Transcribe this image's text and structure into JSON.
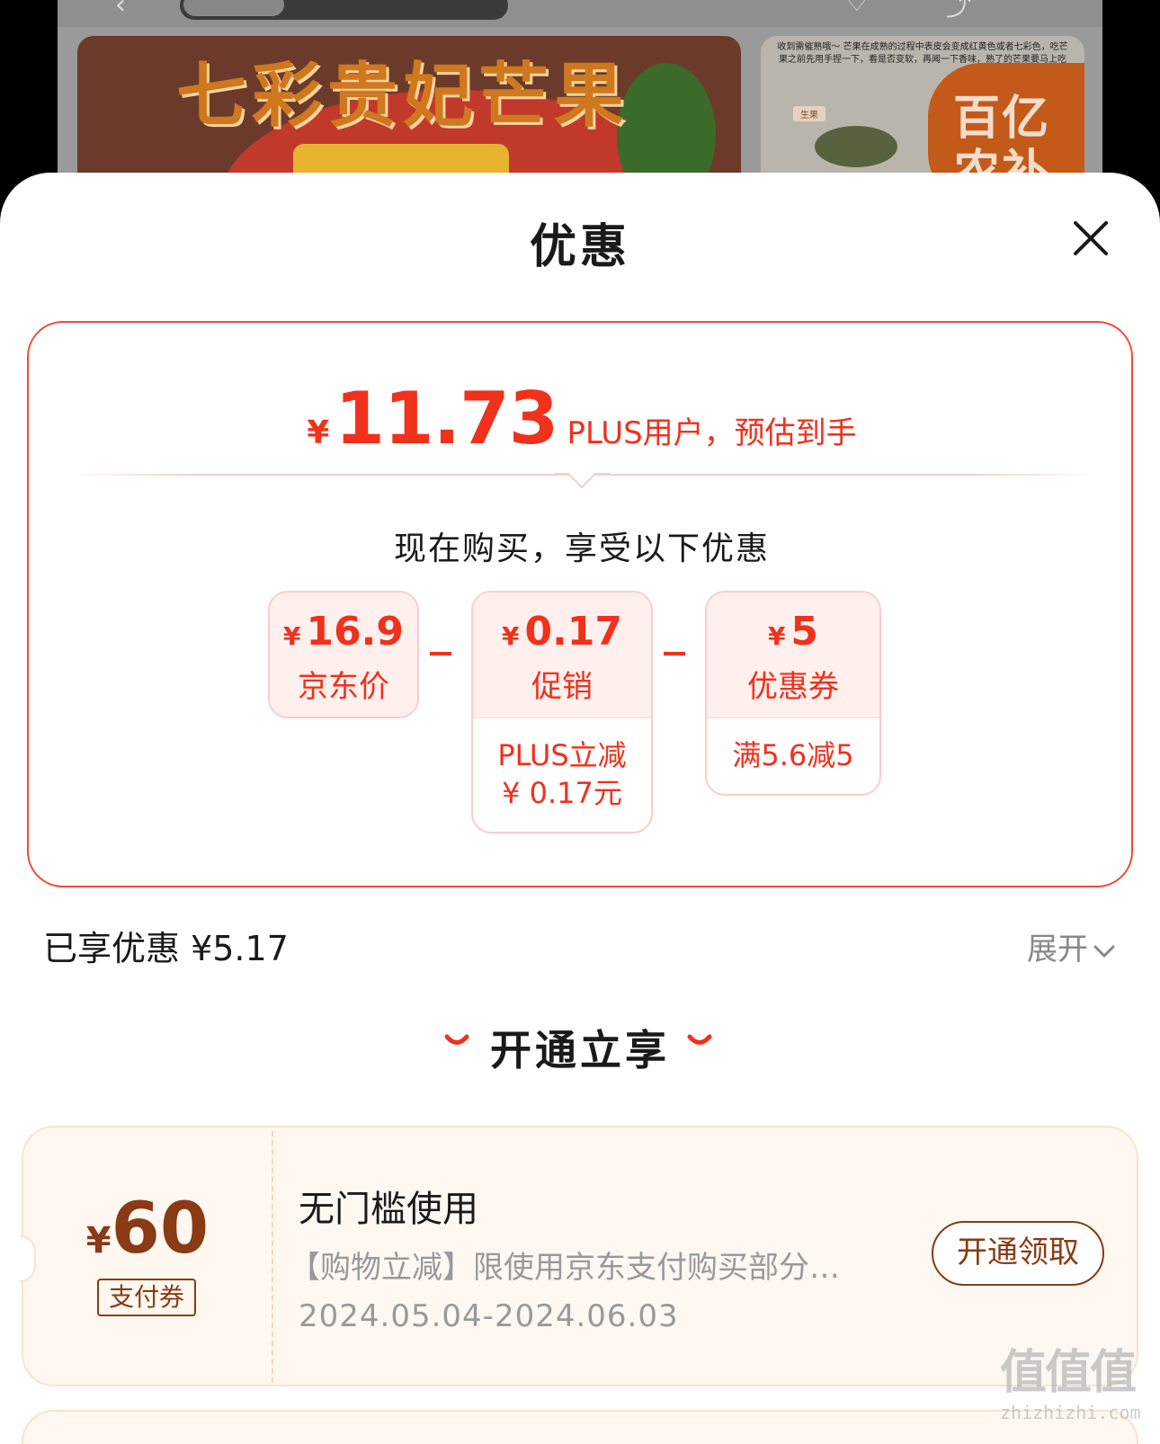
{
  "background": {
    "product_banner_title": "七彩贵妃芒果",
    "ripening_tip": "收到需催熟哦～ 芒果在成熟的过程中表皮会变成红黄色或者七彩色，吃芒果之前先用手捏一下，看是否变软，再闻一下香味，熟了的芒果要马上吃",
    "raw_fruit_tag": "生果",
    "badge_text": "百亿农补"
  },
  "sheet": {
    "title": "优惠",
    "price": {
      "currency": "¥",
      "value": "11.73",
      "note": "PLUS用户，预估到手"
    },
    "buy_now_text": "现在购买，享受以下优惠",
    "breakdown": [
      {
        "currency": "¥",
        "amount": "16.9",
        "label": "京东价"
      },
      {
        "currency": "¥",
        "amount": "0.17",
        "label": "促销",
        "detail": "PLUS立减 ¥ 0.17元"
      },
      {
        "currency": "¥",
        "amount": "5",
        "label": "优惠券",
        "detail": "满5.6减5"
      }
    ],
    "enjoyed_text": "已享优惠 ¥5.17",
    "expand_label": "展开",
    "section_heading": "开通立享",
    "coupon": {
      "currency": "¥",
      "amount": "60",
      "tag": "支付券",
      "title": "无门槛使用",
      "description": "【购物立减】限使用京东支付购买部分…",
      "date_range": "2024.05.04-2024.06.03",
      "button_label": "开通领取"
    }
  },
  "watermark": {
    "logo": "值值值",
    "text": "zhizhizhi.com"
  },
  "colors": {
    "accent_red": "#f0311c",
    "coupon_brown": "#8a3a14",
    "coupon_bg": "#fff8f1"
  }
}
